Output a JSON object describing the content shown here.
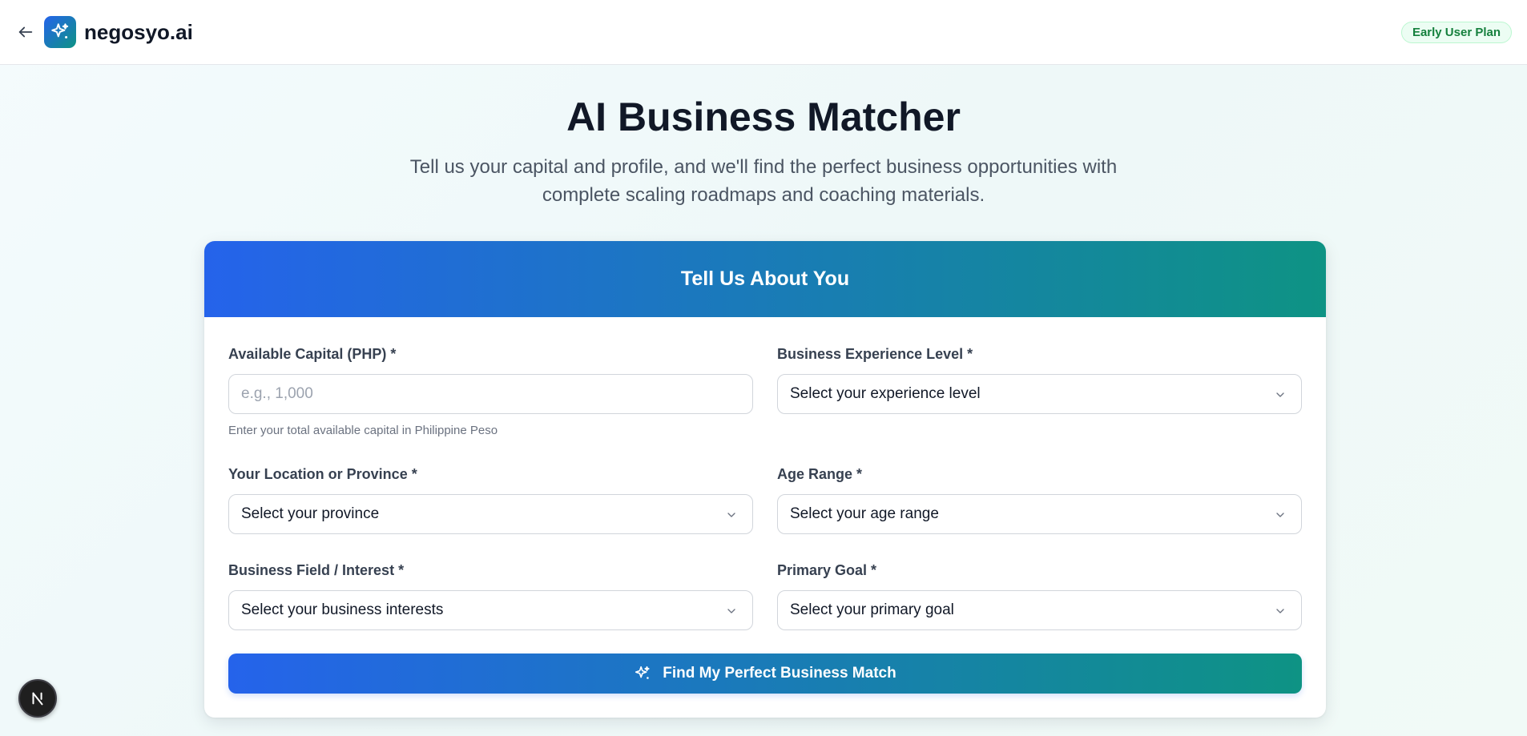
{
  "header": {
    "brand": "negosyo.ai",
    "plan_badge": "Early User Plan"
  },
  "hero": {
    "title": "AI Business Matcher",
    "subtitle": "Tell us your capital and profile, and we'll find the perfect business opportunities with complete scaling roadmaps and coaching materials."
  },
  "form": {
    "card_title": "Tell Us About You",
    "capital": {
      "label": "Available Capital (PHP) *",
      "placeholder": "e.g., 1,000",
      "value": "",
      "hint": "Enter your total available capital in Philippine Peso"
    },
    "experience": {
      "label": "Business Experience Level *",
      "selected": "Select your experience level"
    },
    "location": {
      "label": "Your Location or Province *",
      "selected": "Select your province"
    },
    "age": {
      "label": "Age Range *",
      "selected": "Select your age range"
    },
    "field": {
      "label": "Business Field / Interest *",
      "selected": "Select your business interests"
    },
    "goal": {
      "label": "Primary Goal *",
      "selected": "Select your primary goal"
    },
    "submit_label": "Find My Perfect Business Match"
  },
  "icons": {
    "back": "arrow-left-icon",
    "logo": "sparkles-icon",
    "select": "chevron-down-icon",
    "submit": "sparkles-icon",
    "dev_badge": "nextjs-icon"
  },
  "colors": {
    "gradient_start": "#2563eb",
    "gradient_end": "#0e9384",
    "badge_text": "#15803d",
    "badge_bg": "#ecfdf3"
  },
  "dev_badge_letter": "N"
}
